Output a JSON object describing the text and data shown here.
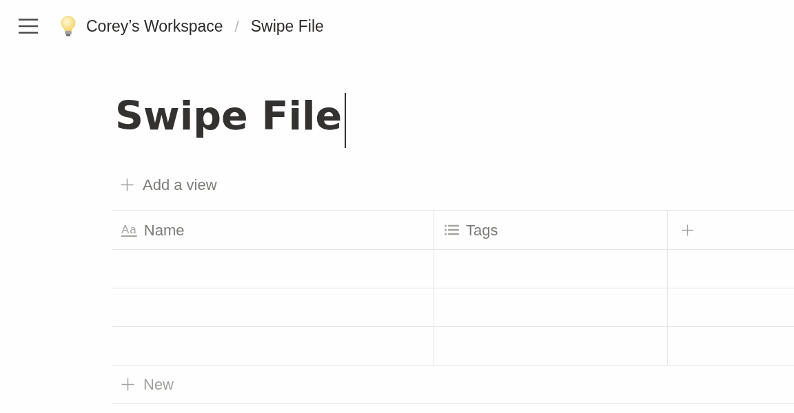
{
  "breadcrumb": {
    "items": [
      {
        "kind": "workspace",
        "label": "Corey’s Workspace"
      },
      {
        "kind": "page",
        "label": "Swipe File"
      }
    ],
    "separator": "/"
  },
  "title": {
    "text": "Swipe File",
    "editing": true
  },
  "add_view": {
    "label": "Add a view"
  },
  "table": {
    "columns": [
      {
        "kind": "text",
        "icon": "Aa",
        "label": "Name"
      },
      {
        "kind": "list",
        "label": "Tags"
      }
    ],
    "rows": [
      {},
      {},
      {}
    ],
    "new_row": {
      "label": "New"
    }
  }
}
